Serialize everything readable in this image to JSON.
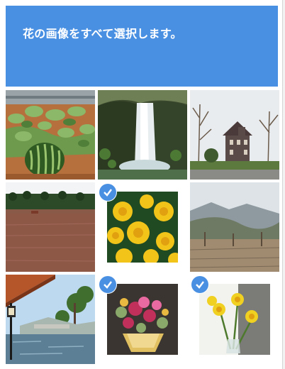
{
  "header": {
    "instruction": "花の画像をすべて選択します。"
  },
  "tiles": [
    {
      "subject": "watermelon-field",
      "selected": false
    },
    {
      "subject": "waterfall",
      "selected": false
    },
    {
      "subject": "house",
      "selected": false
    },
    {
      "subject": "field",
      "selected": false
    },
    {
      "subject": "marigold-flowers",
      "selected": true
    },
    {
      "subject": "hills",
      "selected": false
    },
    {
      "subject": "river-village",
      "selected": false
    },
    {
      "subject": "flower-bouquet",
      "selected": true
    },
    {
      "subject": "daffodils",
      "selected": true
    }
  ],
  "colors": {
    "header": "#4a90e2",
    "check": "#4a90e2"
  }
}
